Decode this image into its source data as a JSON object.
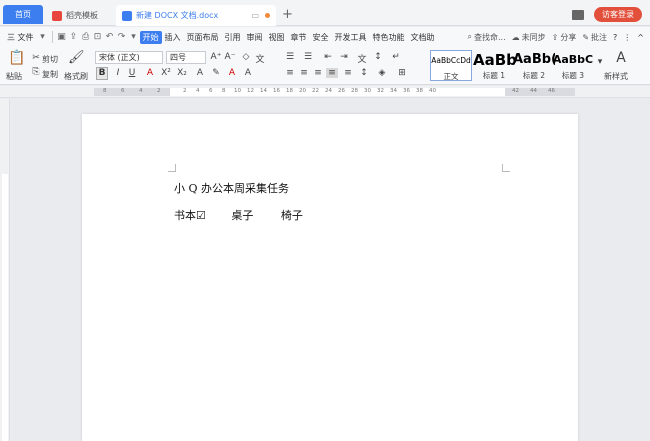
{
  "titlebar": {
    "home_tab": "首页",
    "template_tab": "稻壳模板",
    "doc_tab": "新建 DOCX 文档.docx",
    "new_tab": "+",
    "login": "访客登录"
  },
  "menu": {
    "file": "三 文件",
    "items": [
      "开始",
      "插入",
      "页面布局",
      "引用",
      "审阅",
      "视图",
      "章节",
      "安全",
      "开发工具",
      "特色功能",
      "文档助"
    ],
    "search": "查找命...",
    "sync": "未同步",
    "share": "分享",
    "annotate": "批注"
  },
  "ribbon": {
    "paste": "粘贴",
    "cut": "剪切",
    "copy": "复制",
    "format_painter": "格式刷",
    "font_name": "宋体 (正文)",
    "font_size": "四号",
    "styles": [
      {
        "preview": "AaBbCcDd",
        "label": "正文"
      },
      {
        "preview": "AaBb",
        "label": "标题 1"
      },
      {
        "preview": "AaBb(",
        "label": "标题 2"
      },
      {
        "preview": "AaBbC",
        "label": "标题 3"
      }
    ],
    "new_style": "新样式"
  },
  "ruler_numbers": [
    "8",
    "6",
    "4",
    "2",
    "2",
    "4",
    "6",
    "8",
    "10",
    "12",
    "14",
    "16",
    "18",
    "20",
    "22",
    "24",
    "26",
    "28",
    "30",
    "32",
    "34",
    "36",
    "38",
    "40",
    "42",
    "44",
    "46"
  ],
  "document": {
    "line1": "小 Q 办公本周采集任务",
    "line2": [
      "书本☑",
      "桌子",
      "椅子"
    ]
  }
}
